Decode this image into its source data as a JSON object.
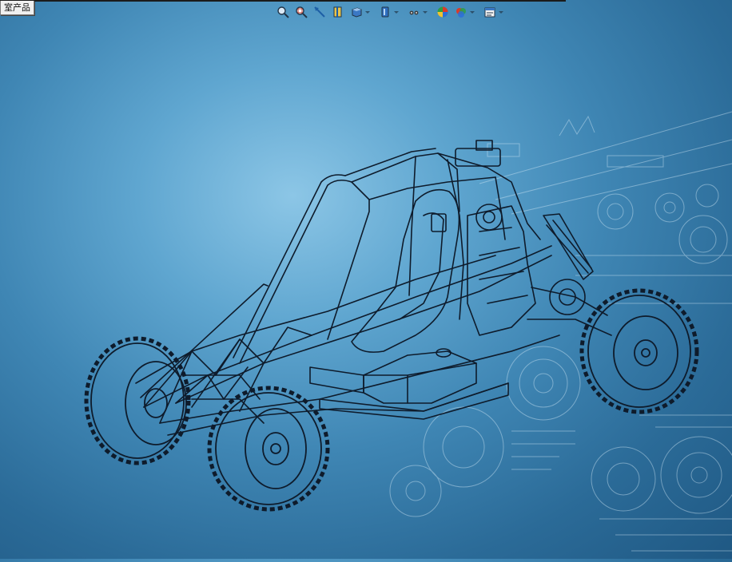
{
  "window": {
    "tab_label": "室产品"
  },
  "toolbar": {
    "icons": [
      "zoom-to-fit-icon",
      "zoom-area-icon",
      "previous-view-icon",
      "section-view-icon",
      "view-orientation-icon",
      "display-style-icon",
      "hide-show-icon",
      "edit-appearance-icon",
      "apply-scene-icon",
      "view-settings-icon"
    ]
  },
  "viewport": {
    "model": "buggy-wireframe-assembly",
    "background": "blueprint-gradient"
  },
  "colors": {
    "wireframe": "#0e1b2b",
    "background_light": "#8cc6e6",
    "background_dark": "#1f5883"
  }
}
